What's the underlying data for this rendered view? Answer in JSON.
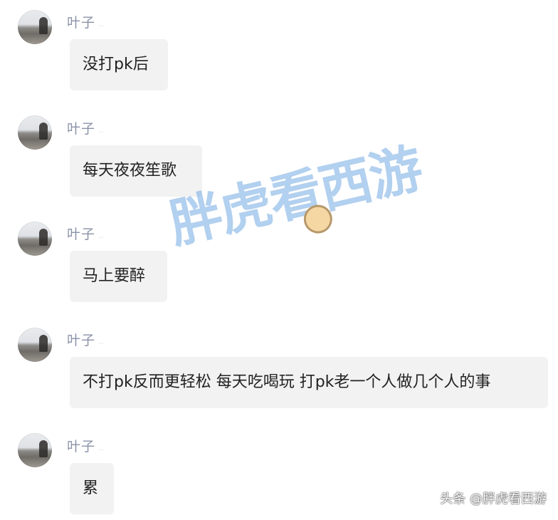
{
  "messages": [
    {
      "sender": "叶子",
      "text": "没打pk后"
    },
    {
      "sender": "叶子",
      "text": "每天夜夜笙歌"
    },
    {
      "sender": "叶子",
      "text": "马上要醉"
    },
    {
      "sender": "叶子",
      "text": "不打pk反而更轻松 每天吃喝玩 打pk老一个人做几个人的事"
    },
    {
      "sender": "叶子",
      "text": "累"
    }
  ],
  "watermark": "胖虎看西游",
  "footer": "头条 @胖虎看西游"
}
